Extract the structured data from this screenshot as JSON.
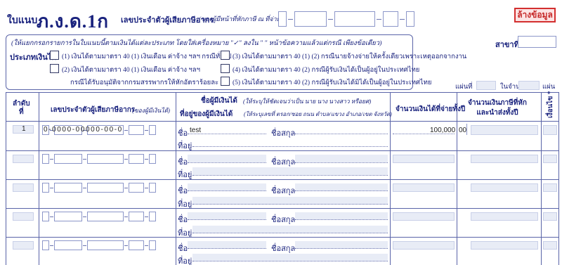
{
  "header": {
    "form_prefix": "ใบแนบ",
    "form_code": "ภ.ง.ด.1ก",
    "taxid_label": "เลขประจำตัวผู้เสียภาษีอากร",
    "taxid_note": "(ของผู้มีหน้าที่หักภาษี ณ ที่จ่าย)",
    "clear_button": "ล้างข้อมูล",
    "branch_label": "สาขาที่"
  },
  "instructions": {
    "line": "(ให้แยกกรอกรายการในใบแนบนี้ตามเงินได้แต่ละประเภท  โดยใส่เครื่องหมาย \"✓\" ลงใน \"   \" หน้าข้อความแล้วแต่กรณี เพียงข้อเดียว)",
    "income_type_label": "ประเภทเงินได้",
    "options": [
      "(1) เงินได้ตามมาตรา 40 (1) เงินเดือน ค่าจ้าง ฯลฯ กรณีทั่วไป",
      "(2) เงินได้ตามมาตรา 40 (1) เงินเดือน ค่าจ้าง ฯลฯ",
      "กรณีได้รับอนุมัติจากกรมสรรพากรให้หักอัตราร้อยละ 3",
      "(3) เงินได้ตามมาตรา 40 (1) (2) กรณีนายจ้างจ่ายให้ครั้งเดียวเพราะเหตุออกจากงาน",
      "(4) เงินได้ตามมาตรา 40 (2) กรณีผู้รับเงินได้เป็นผู้อยู่ในประเทศไทย",
      "(5) เงินได้ตามมาตรา 40 (2) กรณีผู้รับเงินได้มิได้เป็นผู้อยู่ในประเทศไทย"
    ]
  },
  "sheet": {
    "sheet_label": "แผ่นที่",
    "of_label": "ในจำนวน",
    "pages_label": "แผ่น"
  },
  "table": {
    "col_seq": "ลำดับ\nที่",
    "col_taxid": "เลขประจำตัวผู้เสียภาษีอากร",
    "col_taxid_note": "(ของผู้มีเงินได้)",
    "col_name": "ชื่อผู้มีเงินได้",
    "col_name_note": "(ให้ระบุให้ชัดเจนว่าเป็น นาย นาง นางสาว หรือยศ)",
    "col_address": "ที่อยู่ของผู้มีเงินได้",
    "col_address_note": "(ให้ระบุเลขที่ ตรอก/ซอย ถนน ตำบล/แขวง อำเภอ/เขต จังหวัด)",
    "col_amount": "จำนวนเงินได้ที่จ่ายทั้งปี",
    "col_tax": "จำนวนเงินภาษีที่หัก\nและนำส่งทั้งปี",
    "col_cond": "เงื่อนไข *",
    "first_label": "ชื่อ",
    "last_label": "ชื่อสกุล",
    "addr_label": "ที่อยู่",
    "rows": [
      {
        "seq": "1",
        "taxid": "0-0000-00000-00-0",
        "first_name": "test",
        "amount": "100,000",
        "satang": "00"
      },
      {
        "seq": "",
        "taxid": "",
        "first_name": "",
        "amount": "",
        "satang": ""
      },
      {
        "seq": "",
        "taxid": "",
        "first_name": "",
        "amount": "",
        "satang": ""
      },
      {
        "seq": "",
        "taxid": "",
        "first_name": "",
        "amount": "",
        "satang": ""
      },
      {
        "seq": "",
        "taxid": "",
        "first_name": "",
        "amount": "",
        "satang": ""
      }
    ]
  },
  "colors": {
    "navy": "#1a237e",
    "border": "#5a64a8",
    "field_fill": "#e8ecf6",
    "clear_button": "#d32f2f"
  }
}
